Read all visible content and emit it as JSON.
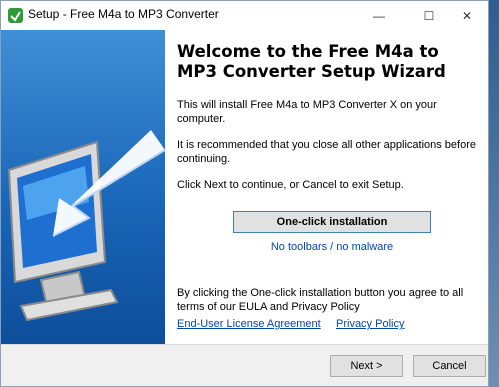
{
  "window": {
    "title": "Setup - Free M4a to MP3 Converter",
    "minimize_glyph": "—",
    "maximize_glyph": "☐",
    "close_glyph": "✕"
  },
  "content": {
    "heading": "Welcome to the Free M4a to MP3 Converter Setup Wizard",
    "intro": "This will install Free M4a to MP3 Converter X on your computer.",
    "recommend": "It is recommended that you close all other applications before continuing.",
    "instructions": "Click Next to continue, or Cancel to exit Setup.",
    "oneclick_label": "One-click installation",
    "no_malware": "No toolbars / no malware",
    "agreement": "By clicking the One-click installation button you agree to all terms of our EULA and Privacy Policy",
    "eula_link": "End-User License Agreement",
    "privacy_link": "Privacy Policy"
  },
  "footer": {
    "next_label": "Next >",
    "cancel_label": "Cancel"
  },
  "colors": {
    "link": "#0645ad",
    "sidebar": "#1a66b8",
    "button_border_focus": "#3c7fb1"
  },
  "icons": {
    "app": "installer-icon",
    "sidebar": "monitor-arrow-illustration"
  }
}
